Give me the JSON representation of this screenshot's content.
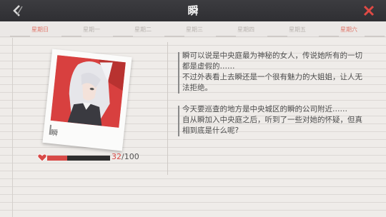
{
  "header": {
    "title": "瞬"
  },
  "weekdays": [
    {
      "label": "星期日",
      "active": true
    },
    {
      "label": "星期一",
      "active": false
    },
    {
      "label": "星期二",
      "active": false
    },
    {
      "label": "星期三",
      "active": false
    },
    {
      "label": "星期四",
      "active": false
    },
    {
      "label": "星期五",
      "active": false
    },
    {
      "label": "星期六",
      "active": true
    }
  ],
  "character": {
    "name": "瞬"
  },
  "affection": {
    "current": "32",
    "separator": "/",
    "max": "100",
    "fraction": 0.32
  },
  "story": {
    "p1_l1": "瞬可以说是中央庭最为神秘的女人，传说她所有的一切",
    "p1_l2": "都是虚假的……",
    "p1_l3": "不过外表看上去瞬还是一个很有魅力的大姐姐，让人无",
    "p1_l4": "法拒绝。",
    "p2_l1": "今天要巡查的地方是中央城区的瞬的公司附近……",
    "p2_l2": "自从瞬加入中央庭之后，听到了一些对她的怀疑，但真",
    "p2_l3": "相到底是什么呢?"
  },
  "colors": {
    "accent_red": "#d84a47",
    "topbar": "#333336",
    "close": "#e04a45"
  },
  "icons": {
    "back": "back-arrow-icon",
    "close": "close-icon",
    "heart": "heart-icon"
  }
}
